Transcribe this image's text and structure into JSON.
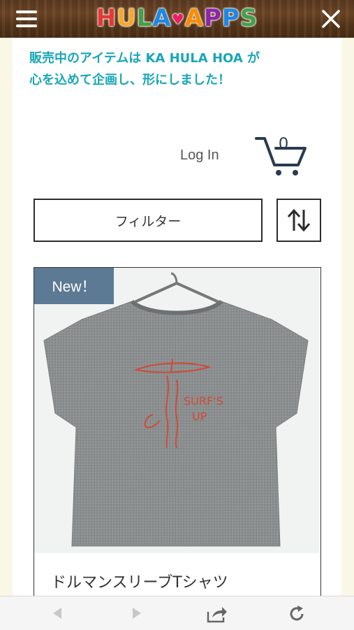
{
  "header": {
    "logo_letters": [
      {
        "ch": "H",
        "color": "#e53935"
      },
      {
        "ch": "U",
        "color": "#f9a825"
      },
      {
        "ch": "L",
        "color": "#43a047"
      },
      {
        "ch": "A",
        "color": "#1e88e5"
      },
      {
        "ch": "♥",
        "color": "#e91e63"
      },
      {
        "ch": "A",
        "color": "#fb8c00"
      },
      {
        "ch": "P",
        "color": "#8e24aa"
      },
      {
        "ch": "P",
        "color": "#1e88e5"
      },
      {
        "ch": "S",
        "color": "#43a047"
      }
    ],
    "menu_icon": "hamburger-menu-icon",
    "close_icon": "close-icon"
  },
  "intro": {
    "line1": "販売中のアイテムは KA HULA HOA が",
    "line2": "心を込めて企画し、形にしました！"
  },
  "account": {
    "login_label": "Log In",
    "cart_count": "0",
    "cart_icon": "cart-icon"
  },
  "controls": {
    "filter_label": "フィルター",
    "sort_icon": "sort-arrows-icon"
  },
  "product": {
    "badge": "New！",
    "name": "ドルマンスリーブTシャツ",
    "print_text_1": "SURF'S",
    "print_text_2": "UP"
  },
  "browser": {
    "icons": [
      "back-arrow-icon",
      "forward-arrow-icon",
      "share-icon",
      "reload-icon"
    ]
  },
  "colors": {
    "accent_teal": "#19a6b8",
    "badge_bg": "#5d7a94",
    "header_wood": "#6e4626"
  }
}
